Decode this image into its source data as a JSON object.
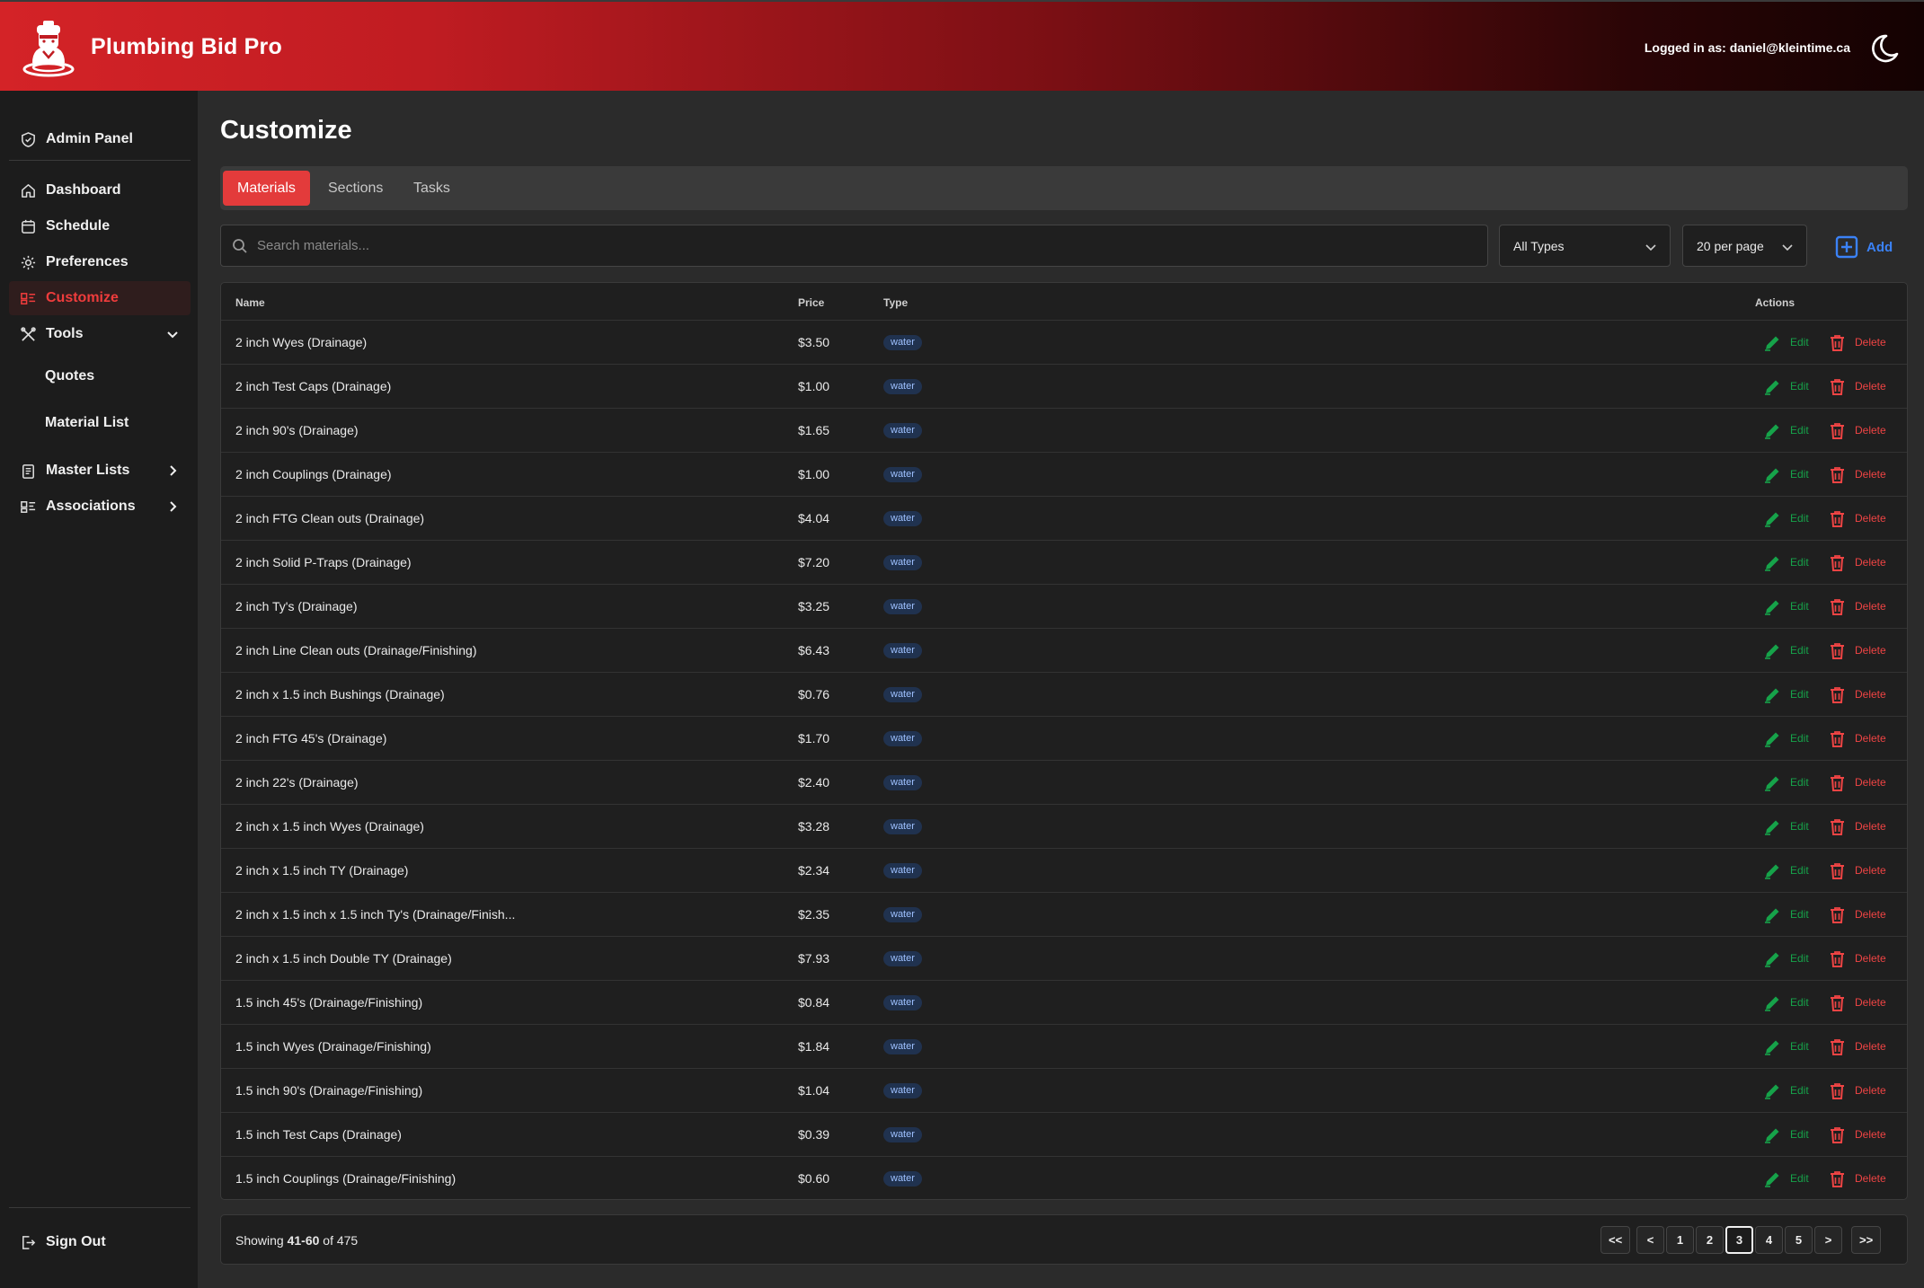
{
  "header": {
    "app_title": "Plumbing Bid Pro",
    "login_text": "Logged in as: daniel@kleintime.ca"
  },
  "sidebar": {
    "admin_panel": "Admin Panel",
    "dashboard": "Dashboard",
    "schedule": "Schedule",
    "preferences": "Preferences",
    "customize": "Customize",
    "tools": "Tools",
    "quotes": "Quotes",
    "material_list": "Material List",
    "master_lists": "Master Lists",
    "associations": "Associations",
    "sign_out": "Sign Out"
  },
  "page": {
    "title": "Customize"
  },
  "tabs": [
    "Materials",
    "Sections",
    "Tasks"
  ],
  "filters": {
    "search_placeholder": "Search materials...",
    "type_select": "All Types",
    "per_page_select": "20 per page",
    "add_label": "Add"
  },
  "table": {
    "headers": {
      "name": "Name",
      "price": "Price",
      "type": "Type",
      "actions": "Actions"
    },
    "edit_label": "Edit",
    "delete_label": "Delete",
    "rows": [
      {
        "name": "2 inch Wyes (Drainage)",
        "price": "$3.50",
        "type": "water"
      },
      {
        "name": "2 inch Test Caps (Drainage)",
        "price": "$1.00",
        "type": "water"
      },
      {
        "name": "2 inch 90's (Drainage)",
        "price": "$1.65",
        "type": "water"
      },
      {
        "name": "2 inch Couplings (Drainage)",
        "price": "$1.00",
        "type": "water"
      },
      {
        "name": "2 inch FTG Clean outs (Drainage)",
        "price": "$4.04",
        "type": "water"
      },
      {
        "name": "2 inch Solid P-Traps (Drainage)",
        "price": "$7.20",
        "type": "water"
      },
      {
        "name": "2 inch Ty's (Drainage)",
        "price": "$3.25",
        "type": "water"
      },
      {
        "name": "2 inch Line Clean outs (Drainage/Finishing)",
        "price": "$6.43",
        "type": "water"
      },
      {
        "name": "2 inch x 1.5 inch Bushings (Drainage)",
        "price": "$0.76",
        "type": "water"
      },
      {
        "name": "2 inch FTG 45's (Drainage)",
        "price": "$1.70",
        "type": "water"
      },
      {
        "name": "2 inch 22's (Drainage)",
        "price": "$2.40",
        "type": "water"
      },
      {
        "name": "2 inch x 1.5 inch Wyes (Drainage)",
        "price": "$3.28",
        "type": "water"
      },
      {
        "name": "2 inch x 1.5 inch TY (Drainage)",
        "price": "$2.34",
        "type": "water"
      },
      {
        "name": "2 inch x 1.5 inch x 1.5 inch Ty's (Drainage/Finish...",
        "price": "$2.35",
        "type": "water"
      },
      {
        "name": "2 inch x 1.5 inch Double TY (Drainage)",
        "price": "$7.93",
        "type": "water"
      },
      {
        "name": "1.5 inch 45's (Drainage/Finishing)",
        "price": "$0.84",
        "type": "water"
      },
      {
        "name": "1.5 inch Wyes (Drainage/Finishing)",
        "price": "$1.84",
        "type": "water"
      },
      {
        "name": "1.5 inch 90's (Drainage/Finishing)",
        "price": "$1.04",
        "type": "water"
      },
      {
        "name": "1.5 inch Test Caps (Drainage)",
        "price": "$0.39",
        "type": "water"
      },
      {
        "name": "1.5 inch Couplings (Drainage/Finishing)",
        "price": "$0.60",
        "type": "water"
      }
    ]
  },
  "pagination": {
    "showing_prefix": "Showing",
    "range": "41-60",
    "of_text": "of 475",
    "buttons": [
      "<<",
      "<",
      "1",
      "2",
      "3",
      "4",
      "5",
      ">",
      ">>"
    ],
    "current_page": "3"
  },
  "colors": {
    "brand_red": "#e33b3b",
    "edit_green": "#16a34a",
    "delete_red": "#ef4444",
    "add_blue": "#3b82f6"
  }
}
